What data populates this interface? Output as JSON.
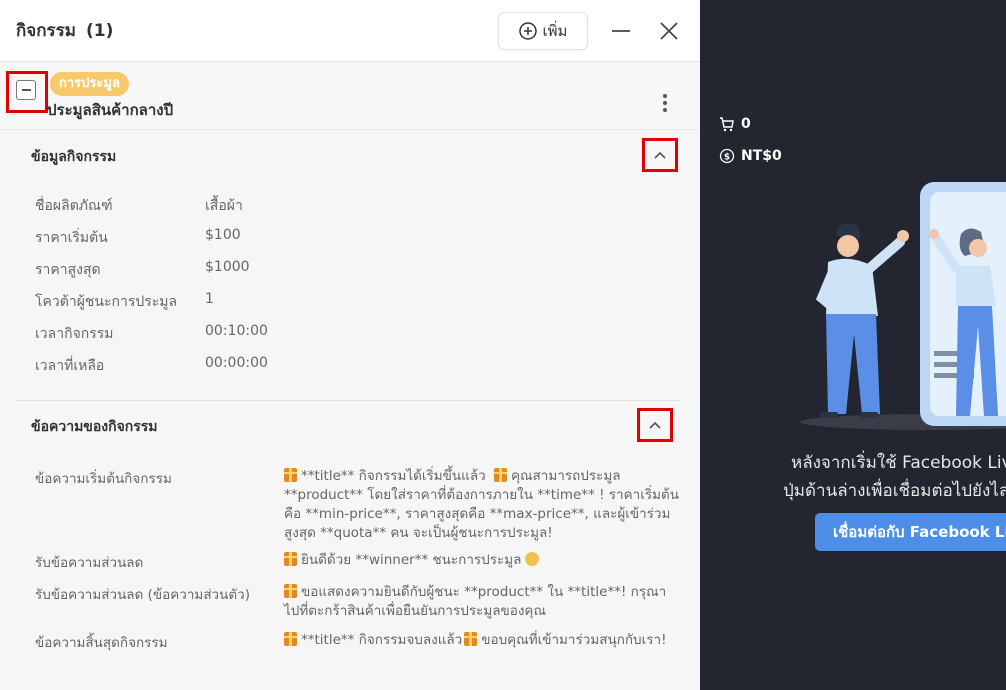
{
  "header": {
    "title": "กิจกรรม",
    "count": "(1)",
    "add_label": "เพิ่ม"
  },
  "event": {
    "tag": "การประมูล",
    "name": "ประมูลสินค้ากลางปี"
  },
  "info_section": {
    "title": "ข้อมูลกิจกรรม",
    "rows": [
      {
        "label": "ชื่อผลิตภัณฑ์",
        "value": "เสื้อผ้า"
      },
      {
        "label": "ราคาเริ่มต้น",
        "value": "$100"
      },
      {
        "label": "ราคาสูงสุด",
        "value": "$1000"
      },
      {
        "label": "โควต้าผู้ชนะการประมูล",
        "value": "1"
      },
      {
        "label": "เวลากิจกรรม",
        "value": "00:10:00"
      },
      {
        "label": "เวลาที่เหลือ",
        "value": "00:00:00"
      }
    ]
  },
  "message_section": {
    "title": "ข้อความของกิจกรรม",
    "rows": [
      {
        "label": "ข้อความเริ่มต้นกิจกรรม",
        "value": "**title** กิจกรรมได้เริ่มขึ้นแล้ว",
        "value2": "คุณสามารถประมูล **product** โดยใส่ราคาที่ต้องการภายใน **time** ! ราคาเริ่มต้นคือ **min-price**, ราคาสูงสุดคือ **max-price**, และผู้เข้าร่วมสูงสุด **quota** คน จะเป็นผู้ชนะการประมูล!"
      },
      {
        "label": "รับข้อความส่วนลด",
        "value": "ยินดีด้วย **winner** ชนะการประมูล"
      },
      {
        "label": "รับข้อความส่วนลด (ข้อความส่วนตัว)",
        "value": "ขอแสดงความยินดีกับผู้ชนะ **product** ใน **title**! กรุณาไปที่ตะกร้าสินค้าเพื่อยืนยันการประมูลของคุณ"
      },
      {
        "label": "ข้อความสิ้นสุดกิจกรรม",
        "value": "**title** กิจกรรมจบลงแล้ว",
        "value2": "ขอบคุณที่เข้ามาร่วมสนุกกับเรา!"
      }
    ]
  },
  "right": {
    "cart_count": "0",
    "balance": "NT$0",
    "text_line1": "หลังจากเริ่มใช้ Facebook Live",
    "text_line2": "ปุ่มด้านล่างเพื่อเชื่อมต่อไปยังไล",
    "connect_label": "เชื่อมต่อกับ Facebook Live"
  },
  "colors": {
    "accent": "#4d8ee8",
    "tag": "#f8c96a",
    "highlight": "#e10000",
    "dark_bg": "#232631"
  },
  "icons": [
    "plus-circle-icon",
    "minimize-icon",
    "close-icon",
    "collapse-icon",
    "more-vertical-icon",
    "chevron-up-icon",
    "cart-icon",
    "dollar-icon",
    "gift-icon",
    "clap-icon"
  ]
}
